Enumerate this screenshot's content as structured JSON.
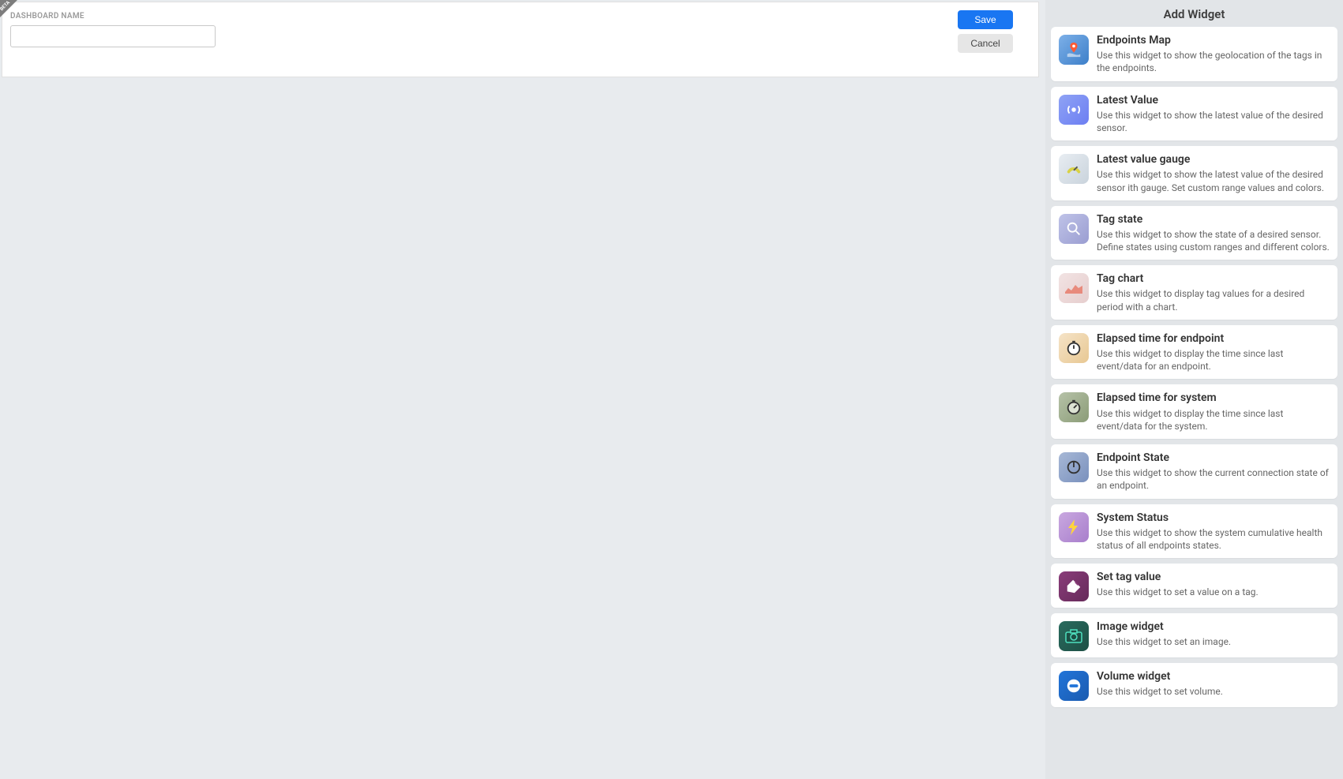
{
  "beta": "BETA",
  "form": {
    "label": "DASHBOARD NAME",
    "value": ""
  },
  "buttons": {
    "save": "Save",
    "cancel": "Cancel"
  },
  "sidebar": {
    "title": "Add Widget",
    "widgets": [
      {
        "title": "Endpoints Map",
        "desc": "Use this widget to show the geolocation of the tags in the endpoints."
      },
      {
        "title": "Latest Value",
        "desc": "Use this widget to show the latest value of the desired sensor."
      },
      {
        "title": "Latest value gauge",
        "desc": "Use this widget to show the latest value of the desired sensor ith gauge. Set custom range values and colors."
      },
      {
        "title": "Tag state",
        "desc": "Use this widget to show the state of a desired sensor. Define states using custom ranges and different colors."
      },
      {
        "title": "Tag chart",
        "desc": "Use this widget to display tag values for a desired period with a chart."
      },
      {
        "title": "Elapsed time for endpoint",
        "desc": "Use this widget to display the time since last event/data for an endpoint."
      },
      {
        "title": "Elapsed time for system",
        "desc": "Use this widget to display the time since last event/data for the system."
      },
      {
        "title": "Endpoint State",
        "desc": "Use this widget to show the current connection state of an endpoint."
      },
      {
        "title": "System Status",
        "desc": "Use this widget to show the system cumulative health status of all endpoints states."
      },
      {
        "title": "Set tag value",
        "desc": "Use this widget to set a value on a tag."
      },
      {
        "title": "Image widget",
        "desc": "Use this widget to set an image."
      },
      {
        "title": "Volume widget",
        "desc": "Use this widget to set volume."
      }
    ]
  }
}
